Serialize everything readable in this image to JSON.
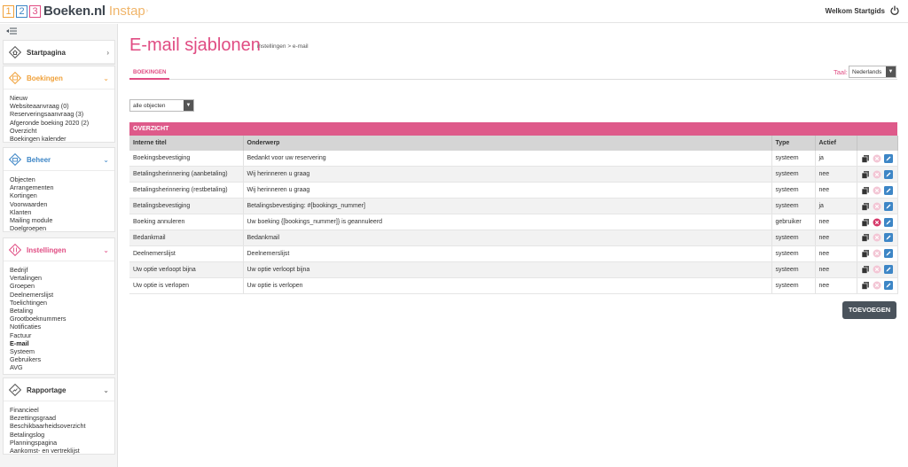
{
  "header": {
    "logo_digits": [
      "1",
      "2",
      "3"
    ],
    "logo_name": "Boeken.nl",
    "logo_suffix": "Instap",
    "welcome": "Welkom Startgids"
  },
  "sidebar": {
    "panels": [
      {
        "title": "Startpagina",
        "chevron": "›",
        "items": []
      },
      {
        "title": "Boekingen",
        "chevron": "⌄",
        "items": [
          "Nieuw",
          "Websiteaanvraag (0)",
          "Reserveringsaanvraag (3)",
          "Afgeronde boeking 2020 (2)",
          "Overzicht",
          "Boekingen kalender"
        ]
      },
      {
        "title": "Beheer",
        "chevron": "⌄",
        "items": [
          "Objecten",
          "Arrangementen",
          "Kortingen",
          "Voorwaarden",
          "Klanten",
          "Mailing module",
          "Doelgroepen"
        ]
      },
      {
        "title": "Instellingen",
        "chevron": "⌄",
        "items": [
          "Bedrijf",
          "Vertalingen",
          "Groepen",
          "Deelnemerslijst",
          "Toelichtingen",
          "Betaling",
          "Grootboeknummers",
          "Notificaties",
          "Factuur",
          "E-mail",
          "Systeem",
          "Gebruikers",
          "AVG"
        ]
      },
      {
        "title": "Rapportage",
        "chevron": "⌄",
        "items": [
          "Financieel",
          "Bezettingsgraad",
          "Beschikbaarheidsoverzicht",
          "Betalingslog",
          "Planningspagina",
          "Aankomst- en vertreklijst"
        ]
      }
    ]
  },
  "main": {
    "title": "E-mail sjablonen",
    "breadcrumb": "instellingen > e-mail",
    "tab": "BOEKINGEN",
    "lang_label": "Taal:",
    "lang_value": "Nederlands",
    "object_filter": "alle objecten",
    "overview_title": "OVERZICHT",
    "columns": [
      "Interne titel",
      "Onderwerp",
      "Type",
      "Actief"
    ],
    "rows": [
      [
        "Boekingsbevestiging",
        "Bedankt voor uw reservering",
        "systeem",
        "ja"
      ],
      [
        "Betalingsherinnering (aanbetaling)",
        "Wij herinneren u graag",
        "systeem",
        "nee"
      ],
      [
        "Betalingsherinnering (restbetaling)",
        "Wij herinneren u graag",
        "systeem",
        "nee"
      ],
      [
        "Betalingsbevestiging",
        "Betalingsbevestiging: #[bookings_nummer]",
        "systeem",
        "ja"
      ],
      [
        "Boeking annuleren",
        "Uw boeking {[bookings_nummer]} is geannuleerd",
        "gebruiker",
        "nee"
      ],
      [
        "Bedankmail",
        "Bedankmail",
        "systeem",
        "nee"
      ],
      [
        "Deelnemerslijst",
        "Deelnemerslijst",
        "systeem",
        "nee"
      ],
      [
        "Uw optie verloopt bijna",
        "Uw optie verloopt bijna",
        "systeem",
        "nee"
      ],
      [
        "Uw optie is verlopen",
        "Uw optie is verlopen",
        "systeem",
        "nee"
      ]
    ],
    "add_button": "TOEVOEGEN"
  },
  "colors": {
    "accent": "#e04c83",
    "orange": "#f0a13a",
    "blue": "#3d86c6",
    "button_dark": "#4a535c"
  }
}
